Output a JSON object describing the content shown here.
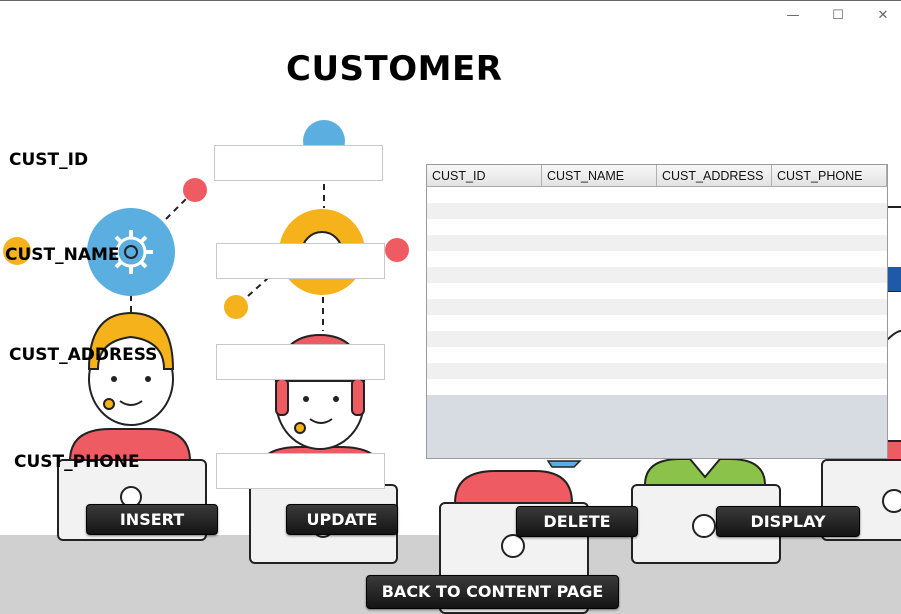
{
  "window": {
    "controls": {
      "minimize": "—",
      "maximize": "☐",
      "close": "✕"
    }
  },
  "header": {
    "title": "CUSTOMER"
  },
  "form": {
    "cust_id_label": "CUST_ID",
    "cust_name_label": "CUST_NAME",
    "cust_address_label": "CUST_ADDRESS",
    "cust_phone_label": "CUST_PHONE",
    "cust_id_value": "",
    "cust_name_value": "",
    "cust_address_value": "",
    "cust_phone_value": ""
  },
  "table": {
    "columns": [
      "CUST_ID",
      "CUST_NAME",
      "CUST_ADDRESS",
      "CUST_PHONE"
    ],
    "rows": []
  },
  "buttons": {
    "insert": "INSERT",
    "update": "UPDATE",
    "delete": "DELETE",
    "display": "DISPLAY",
    "back": "BACK TO CONTENT PAGE"
  },
  "illustration": {
    "colors": {
      "blue": "#5aaee0",
      "yellow": "#f5b21b",
      "red": "#ef5b63",
      "green": "#8bc34a",
      "floor": "#d0d0d0",
      "laptop": "#f2f2f2"
    }
  }
}
